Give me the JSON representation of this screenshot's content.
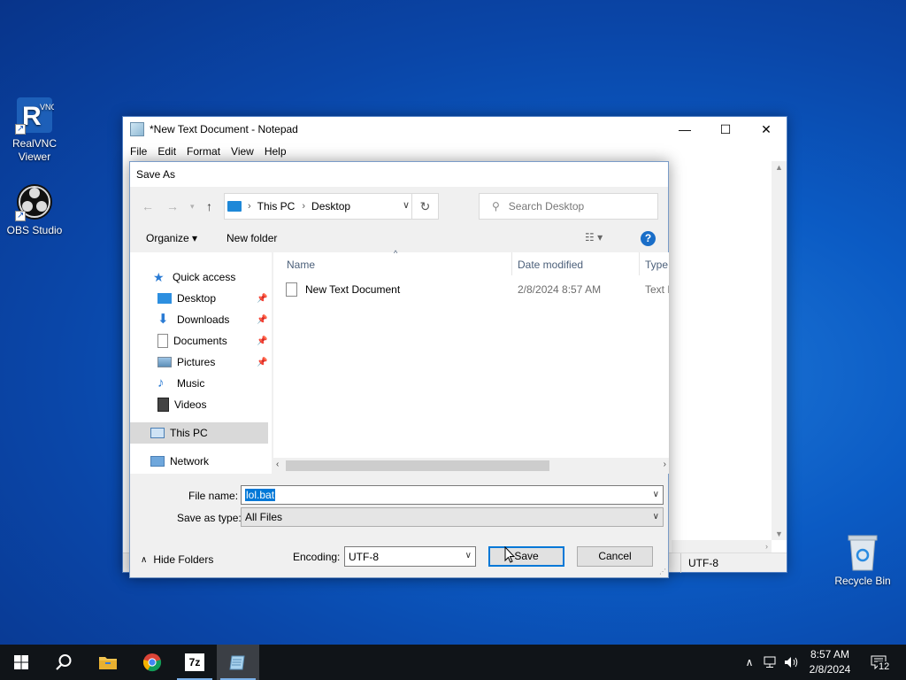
{
  "desktop": {
    "icons": [
      {
        "label_line1": "RealVNC",
        "label_line2": "Viewer"
      },
      {
        "label_line1": "OBS Studio",
        "label_line2": ""
      },
      {
        "label_line1": "Recycle Bin",
        "label_line2": ""
      }
    ]
  },
  "notepad": {
    "title": "*New Text Document - Notepad",
    "menu": [
      "File",
      "Edit",
      "Format",
      "View",
      "Help"
    ],
    "status_encoding": "UTF-8"
  },
  "dialog": {
    "title": "Save As",
    "breadcrumb": [
      "This PC",
      "Desktop"
    ],
    "search_placeholder": "Search Desktop",
    "organize_label": "Organize",
    "new_folder_label": "New folder",
    "help_label": "?",
    "nav": {
      "quick_access": "Quick access",
      "items": [
        "Desktop",
        "Downloads",
        "Documents",
        "Pictures",
        "Music",
        "Videos"
      ],
      "this_pc": "This PC",
      "network": "Network"
    },
    "columns": {
      "name": "Name",
      "date_modified": "Date modified",
      "type": "Type"
    },
    "files": [
      {
        "name": "New Text Document",
        "date_modified": "2/8/2024 8:57 AM",
        "type": "Text D"
      }
    ],
    "file_name_label": "File name:",
    "file_name_value": "lol.bat",
    "save_type_label": "Save as type:",
    "save_type_value": "All Files",
    "hide_folders_label": "Hide Folders",
    "encoding_label": "Encoding:",
    "encoding_value": "UTF-8",
    "save_label": "Save",
    "cancel_label": "Cancel"
  },
  "taskbar": {
    "clock_time": "8:57 AM",
    "clock_date": "2/8/2024",
    "notification_count": "12",
    "apps": [
      "start-icon",
      "search-icon",
      "file-explorer-icon",
      "chrome-icon",
      "7zip-icon",
      "notepad-icon"
    ],
    "seven_zip_label": "7z"
  },
  "colors": {
    "accent": "#0078d7",
    "taskbar": "#101418",
    "desktop": "#0b5bc4"
  }
}
